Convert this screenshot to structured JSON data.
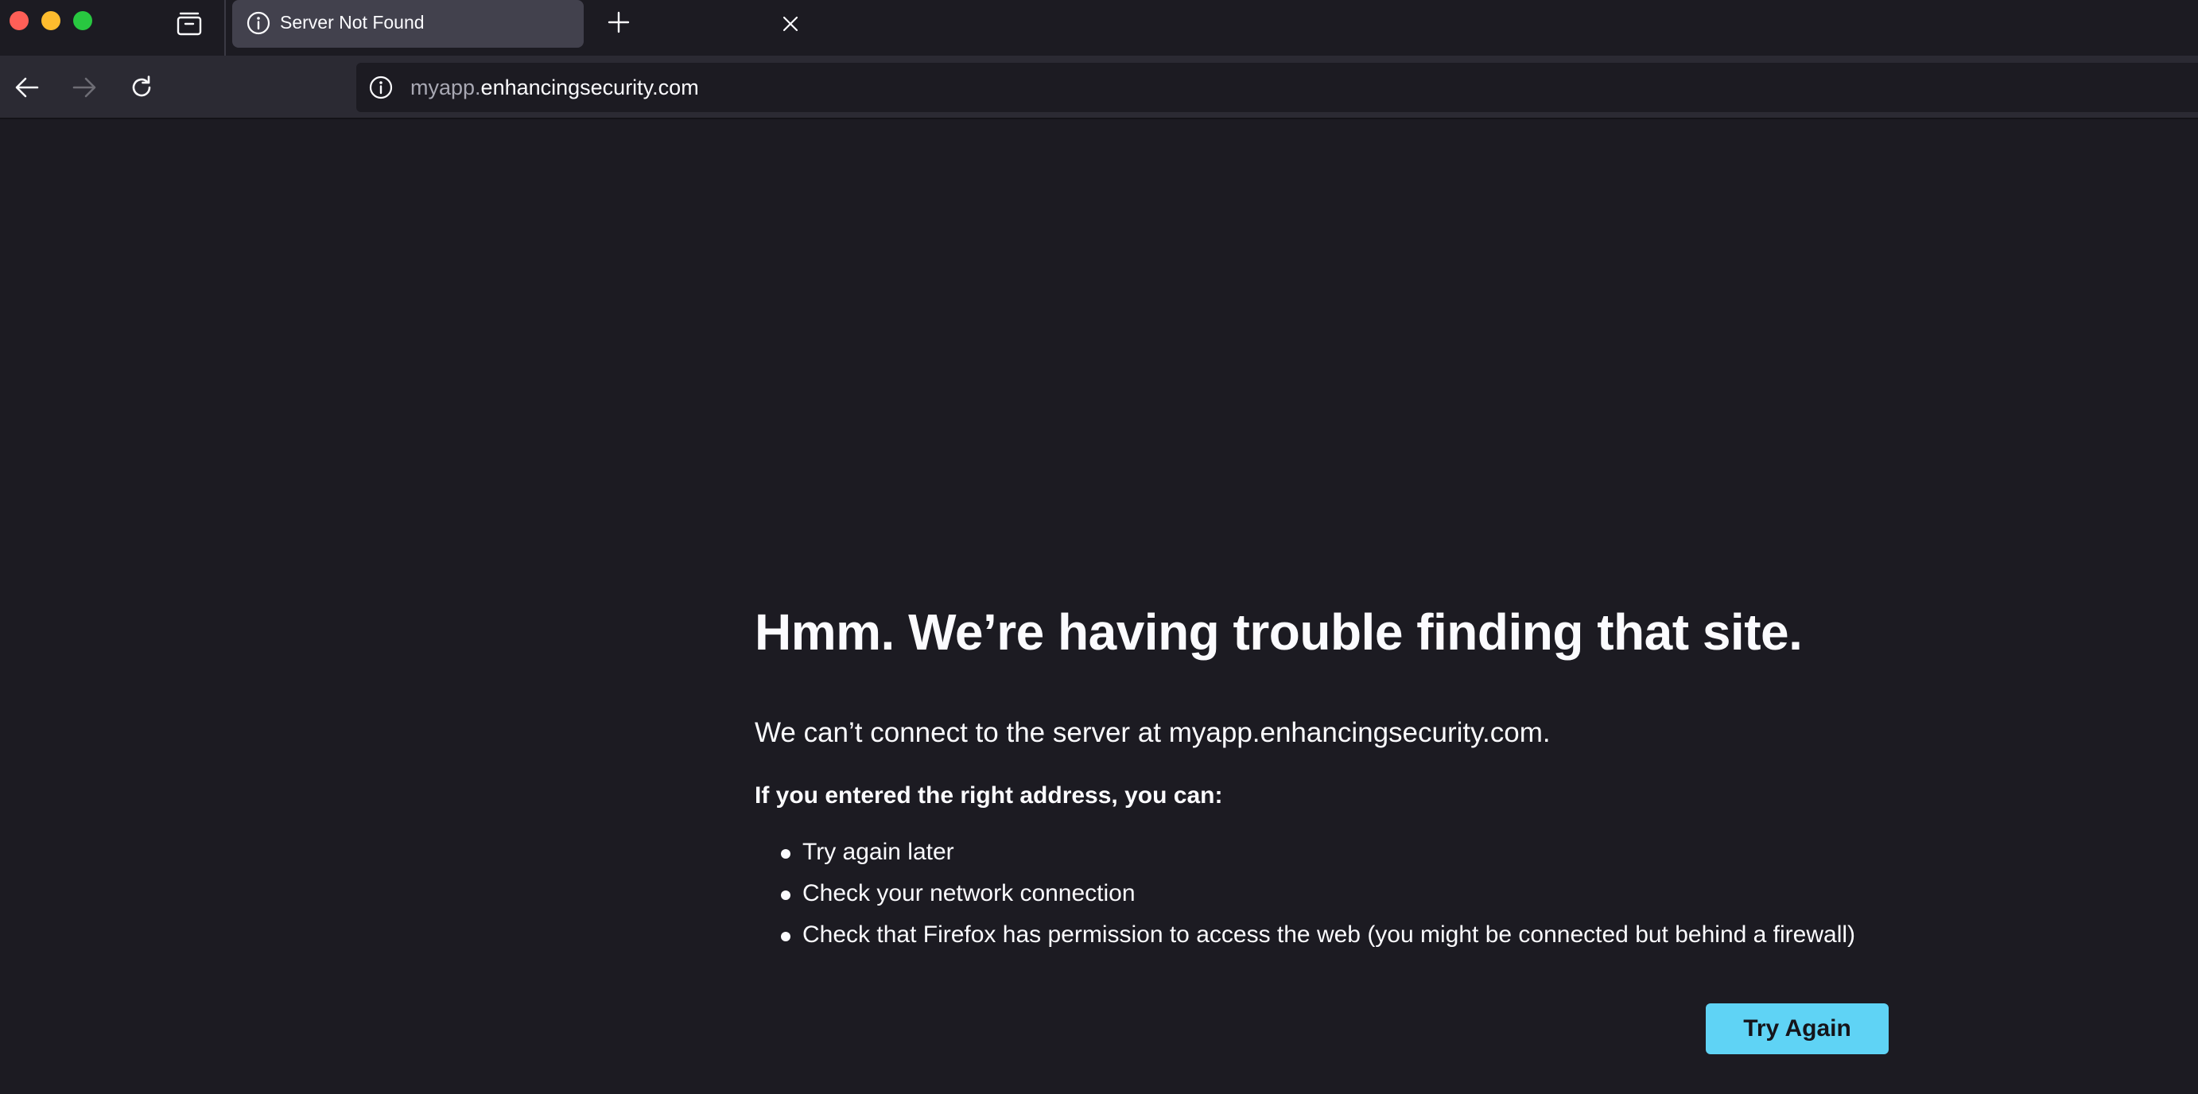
{
  "window": {
    "controls": [
      "close",
      "minimize",
      "maximize"
    ]
  },
  "tabstrip": {
    "tab_manager_icon": "tab-manager-icon",
    "tabs": [
      {
        "title": "Server Not Found",
        "icon": "info-icon",
        "active": true
      }
    ],
    "new_tab_icon": "plus-icon"
  },
  "navbar": {
    "back_icon": "arrow-left-icon",
    "forward_icon": "arrow-right-icon",
    "reload_icon": "reload-icon",
    "url_subdomain": "myapp.",
    "url_domain": "enhancingsecurity.com"
  },
  "error": {
    "title": "Hmm. We’re having trouble finding that site.",
    "description": "We can’t connect to the server at myapp.enhancingsecurity.com.",
    "subheading": "If you entered the right address, you can:",
    "suggestions": [
      "Try again later",
      "Check your network connection",
      "Check that Firefox has permission to access the web (you might be connected but behind a firewall)"
    ],
    "button_label": "Try Again"
  },
  "colors": {
    "background": "#1c1b22",
    "toolbar": "#2b2a33",
    "active_tab": "#42414d",
    "text": "#fbfbfe",
    "muted_text": "#a8a8b3",
    "primary_button": "#5fd3f5",
    "traffic_close": "#ff5f57",
    "traffic_minimize": "#febc2e",
    "traffic_maximize": "#28c840"
  }
}
